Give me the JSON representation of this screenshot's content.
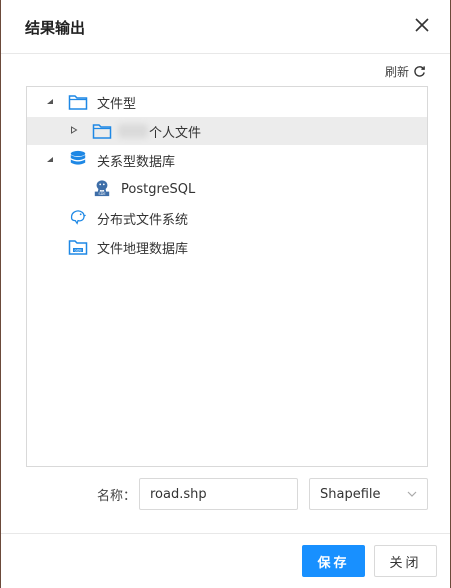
{
  "dialog": {
    "title": "结果输出",
    "refresh_label": "刷新"
  },
  "tree": {
    "nodes": [
      {
        "label": "文件型",
        "icon": "folder-icon",
        "expanded": true
      },
      {
        "label": "个人文件",
        "icon": "folder-icon",
        "expanded": false,
        "selected": true
      },
      {
        "label": "关系型数据库",
        "icon": "database-icon",
        "expanded": true
      },
      {
        "label": "PostgreSQL",
        "icon": "postgresql-icon"
      },
      {
        "label": "分布式文件系统",
        "icon": "hadoop-icon"
      },
      {
        "label": "文件地理数据库",
        "icon": "gdb-folder-icon"
      }
    ]
  },
  "form": {
    "name_label": "名称：",
    "name_value": "road.shp",
    "format_value": "Shapefile"
  },
  "buttons": {
    "save": "保存",
    "close": "关闭"
  },
  "colors": {
    "primary": "#1890ff",
    "selected_row": "#ececec",
    "folder_blue": "#1e88e5"
  }
}
